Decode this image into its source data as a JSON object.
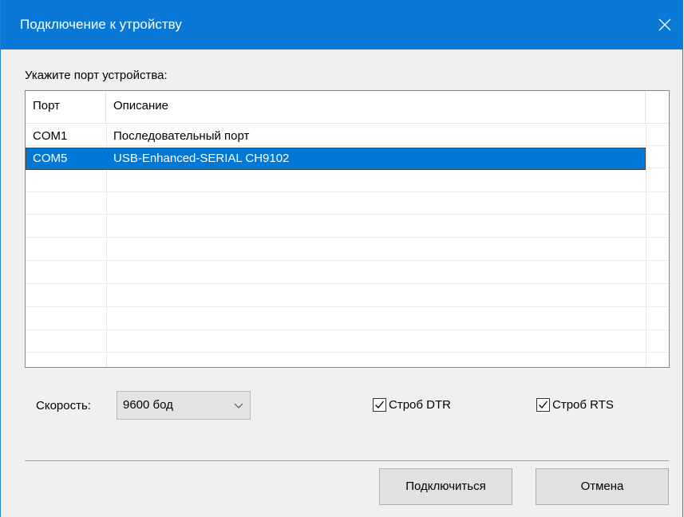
{
  "window": {
    "title": "Подключение к утройству"
  },
  "prompt": "Укажите порт устройства:",
  "ports_list": {
    "columns": [
      "Порт",
      "Описание"
    ],
    "rows": [
      {
        "port": "COM1",
        "description": "Последовательный порт"
      },
      {
        "port": "COM5",
        "description": "USB-Enhanced-SERIAL CH9102",
        "selected": true
      }
    ]
  },
  "speed": {
    "label": "Скорость:",
    "value": "9600 бод"
  },
  "options": {
    "dtr": {
      "label": "Строб DTR",
      "checked": true
    },
    "rts": {
      "label": "Строб RTS",
      "checked": true
    }
  },
  "buttons": {
    "connect": "Подключиться",
    "cancel": "Отмена"
  },
  "colors": {
    "titlebar": "#0a78d7",
    "selection": "#0078d7"
  },
  "icons": {
    "close": "close-icon",
    "dropdown": "chevron-down-icon",
    "check": "checkmark-icon"
  }
}
